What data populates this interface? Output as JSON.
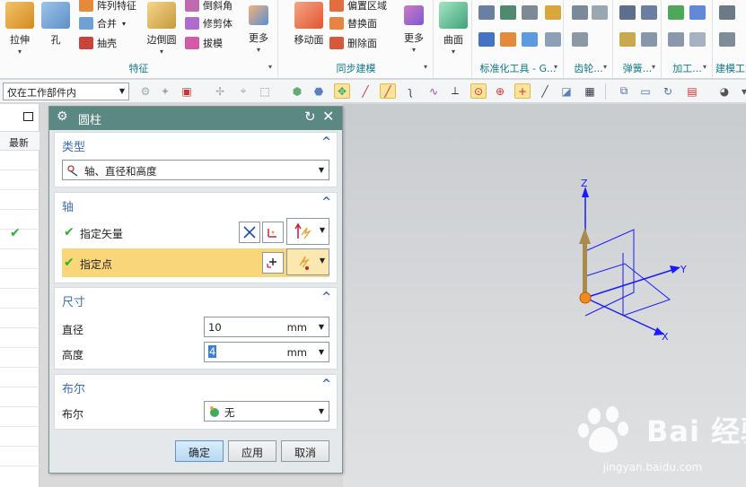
{
  "ribbon": {
    "groups": [
      {
        "label": "特征"
      },
      {
        "label": "同步建模"
      },
      {
        "label": "标准化工具 - G..."
      },
      {
        "label": "齿轮..."
      },
      {
        "label": "弹簧..."
      },
      {
        "label": "加工..."
      },
      {
        "label": "建模工..."
      }
    ],
    "buttons": {
      "extrude": "拉伸",
      "hole": "孔",
      "pattern_feature": "阵列特征",
      "unite": "合并",
      "shell": "抽壳",
      "edge_blend": "边倒圆",
      "chamfer": "倒斜角",
      "trim_body": "修剪体",
      "draft": "拔模",
      "more_feature": "更多",
      "move_face": "移动面",
      "offset_region": "偏置区域",
      "replace_face": "替换面",
      "delete_face": "删除面",
      "more_sync": "更多",
      "surface": "曲面"
    }
  },
  "toolbar": {
    "selection_filter": "仅在工作部件内"
  },
  "navigator": {
    "column_header": "最新"
  },
  "dialog": {
    "title": "圆柱",
    "type_section": {
      "header": "类型",
      "value": "轴、直径和高度"
    },
    "axis_section": {
      "header": "轴",
      "specify_vector": "指定矢量",
      "specify_point": "指定点"
    },
    "dimensions_section": {
      "header": "尺寸",
      "diameter_label": "直径",
      "diameter_value": "10",
      "diameter_unit": "mm",
      "height_label": "高度",
      "height_value": "4",
      "height_unit": "mm"
    },
    "boolean_section": {
      "header": "布尔",
      "label": "布尔",
      "value": "无"
    },
    "buttons": {
      "ok": "确定",
      "apply": "应用",
      "cancel": "取消"
    }
  },
  "viewport": {
    "axis_labels": {
      "z": "Z",
      "y": "Y",
      "x": "X"
    },
    "watermark_text": "Bai 经验",
    "watermark_url": "jingyan.baidu.com"
  },
  "colors": {
    "dialog_title_bg": "#5b8883",
    "section_header": "#3b6db6",
    "highlight_row": "#fad67a",
    "triad_blue": "#1a1aff",
    "vector_tan": "#a98b4e",
    "point_orange": "#f08a1d",
    "check_green": "#2bb32b"
  }
}
